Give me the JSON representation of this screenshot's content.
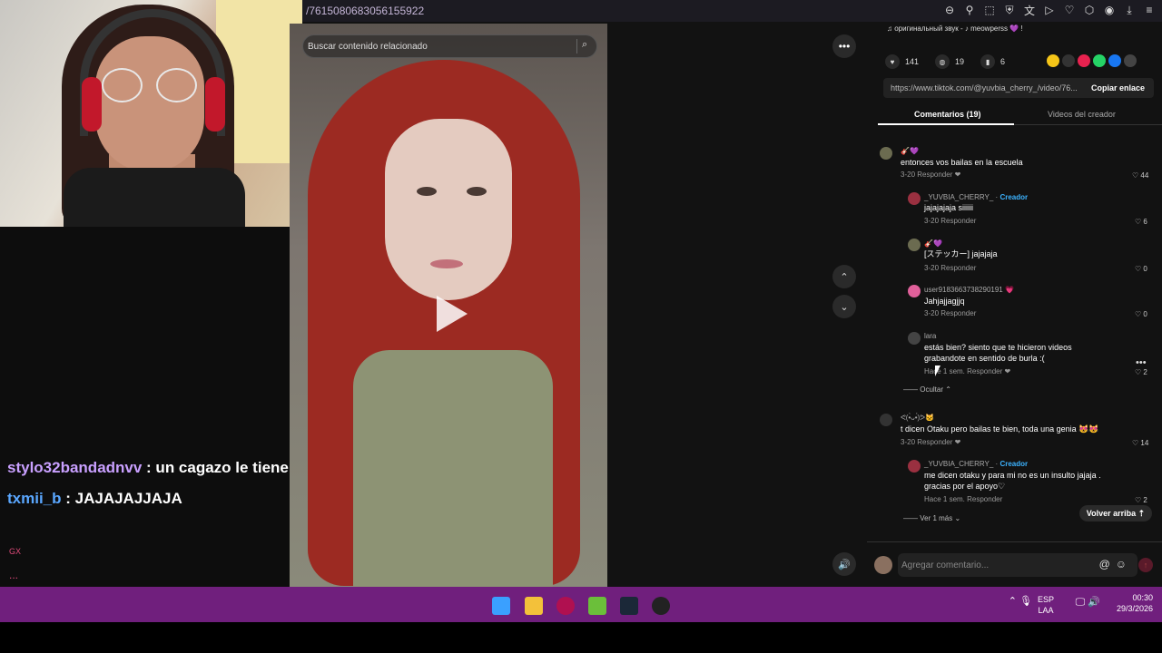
{
  "browser": {
    "url": "/7615080683056155922",
    "icons": [
      "zoom-out-icon",
      "pin-icon",
      "crop-icon",
      "shield-icon",
      "translate-icon",
      "forward-icon",
      "heart-icon",
      "extension-icon",
      "profile-icon",
      "download-icon",
      "menu-icon"
    ]
  },
  "chat": {
    "messages": [
      {
        "user": "stylo32bandadnvv",
        "text": " : un cagazo le tiene"
      },
      {
        "user": "txmii_b",
        "text": " : JAJAJAJJAJA"
      }
    ],
    "footer_tag": "GX",
    "footer_dots": "..."
  },
  "video": {
    "search_placeholder": "Buscar contenido relacionado"
  },
  "panel": {
    "sound": "♫ оригинальный звук - ♪ meowperss 💜 !",
    "likes": "141",
    "comments": "19",
    "saves": "6",
    "link": "https://www.tiktok.com/@yuvbia_cherry_/video/76...",
    "copy_label": "Copiar enlace",
    "tab_comments": "Comentarios (19)",
    "tab_creator": "Videos del creador",
    "comments_list": [
      {
        "name": "🎸💜",
        "text": "entonces vos bailas en la escuela",
        "meta": "3-20   Responder  ❤",
        "likes": "♡ 44"
      },
      {
        "name": "_YUVBIA_CHERRY_ · ",
        "creator": "Creador",
        "text": "jajajajaja siiiiii",
        "meta": "3-20   Responder",
        "likes": "♡ 6"
      },
      {
        "name": "🎸💜",
        "text": "[ステッカー] jajajaja",
        "meta": "3-20   Responder",
        "likes": "♡ 0"
      },
      {
        "name": "user9183663738290191 💗",
        "text": "Jahjajjagjjq",
        "meta": "3-20   Responder",
        "likes": "♡ 0"
      },
      {
        "name": "lara",
        "text": "estás bien? siento que te hicieron videos",
        "text2": "grabandote en sentido de burla :(",
        "meta": "Hace 1 sem.   Responder  ❤",
        "likes": "♡ 2"
      },
      {
        "name": "ᕙ(•̀ᴗ•́)ᕗ🐱",
        "text": "t dicen Otaku pero bailas te bien, toda una genia 😻😻",
        "meta": "3-20   Responder  ❤",
        "likes": "♡ 14"
      },
      {
        "name": "_YUVBIA_CHERRY_ · ",
        "creator": "Creador",
        "text": "me dicen otaku y para mi no es un insulto jajaja .",
        "text2": "gracias por el apoyo♡",
        "meta": "Hace 1 sem.   Responder",
        "likes": "♡ 2"
      }
    ],
    "hide_label": "—— Ocultar ⌃",
    "more_label": "—— Ver 1 más ⌄",
    "back_top": "Volver arriba ⇡",
    "add_comment_placeholder": "Agregar comentario...",
    "add_comment_icons": "@☺"
  },
  "taskbar": {
    "lang": "ESP",
    "lang2": "LAA",
    "time": "00:30",
    "date": "29/3/2026"
  }
}
